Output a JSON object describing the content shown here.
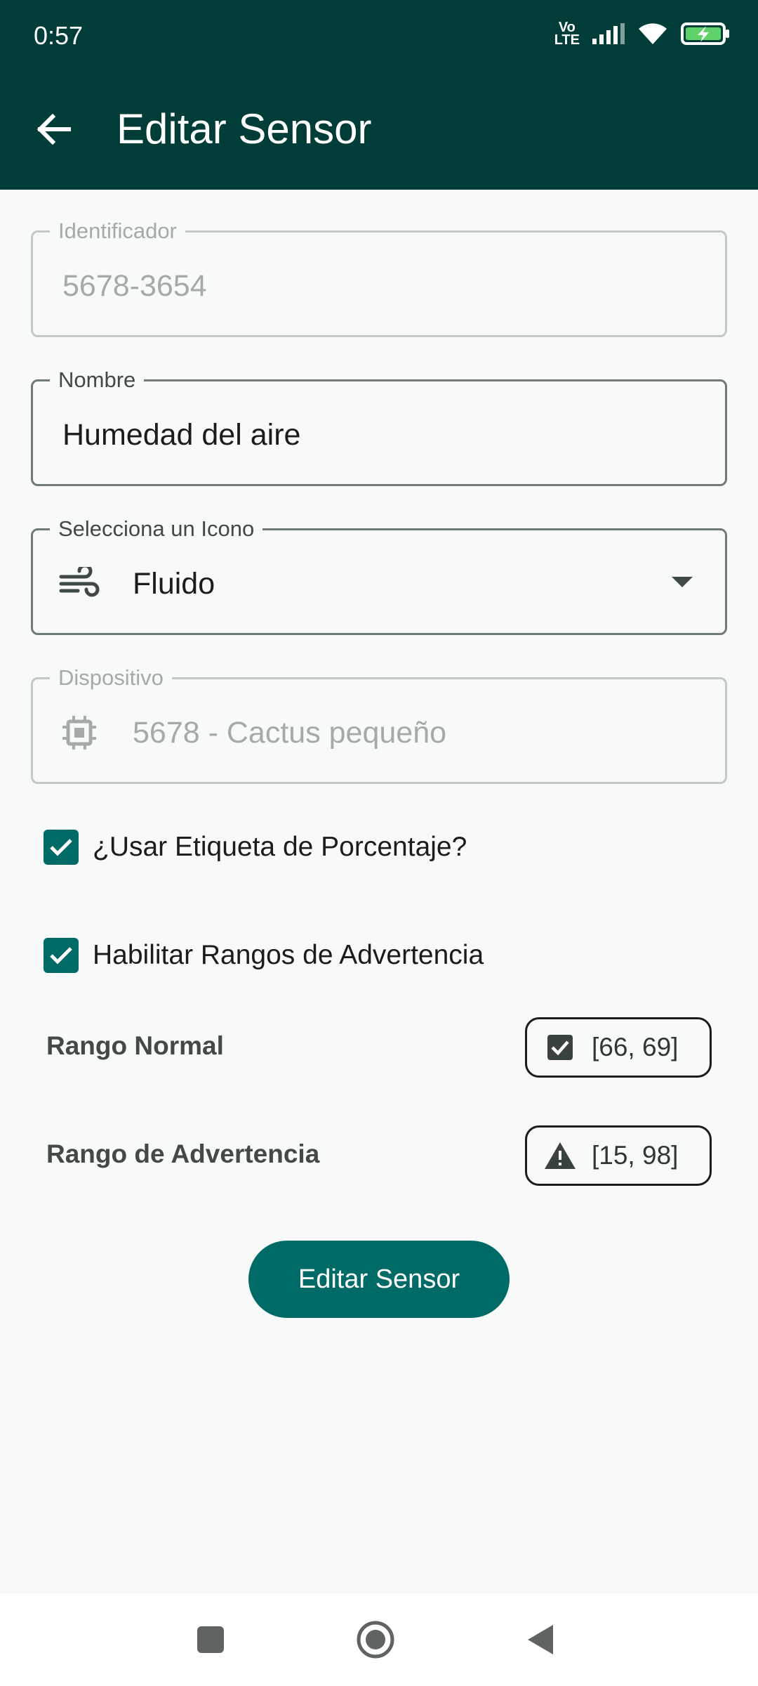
{
  "status_bar": {
    "time": "0:57",
    "network_label": "Vo\nLTE"
  },
  "app_bar": {
    "title": "Editar Sensor"
  },
  "fields": {
    "identifier": {
      "label": "Identificador",
      "value": "5678-3654"
    },
    "name": {
      "label": "Nombre",
      "value": "Humedad del aire"
    },
    "icon": {
      "label": "Selecciona un Icono",
      "value": "Fluido",
      "icon": "wind-icon"
    },
    "device": {
      "label": "Dispositivo",
      "value": "5678 - Cactus pequeño",
      "icon": "chip-icon"
    }
  },
  "checkboxes": {
    "percentage": {
      "label": "¿Usar Etiqueta de Porcentaje?",
      "checked": true
    },
    "ranges": {
      "label": "Habilitar Rangos de Advertencia",
      "checked": true
    }
  },
  "ranges": {
    "normal": {
      "label": "Rango Normal",
      "value": "[66, 69]",
      "icon": "checkbox-icon"
    },
    "warning": {
      "label": "Rango de Advertencia",
      "value": "[15, 98]",
      "icon": "warning-icon"
    }
  },
  "actions": {
    "submit_label": "Editar Sensor"
  },
  "colors": {
    "app_bar": "#003c38",
    "primary": "#006a66",
    "background": "#f8fafa"
  }
}
